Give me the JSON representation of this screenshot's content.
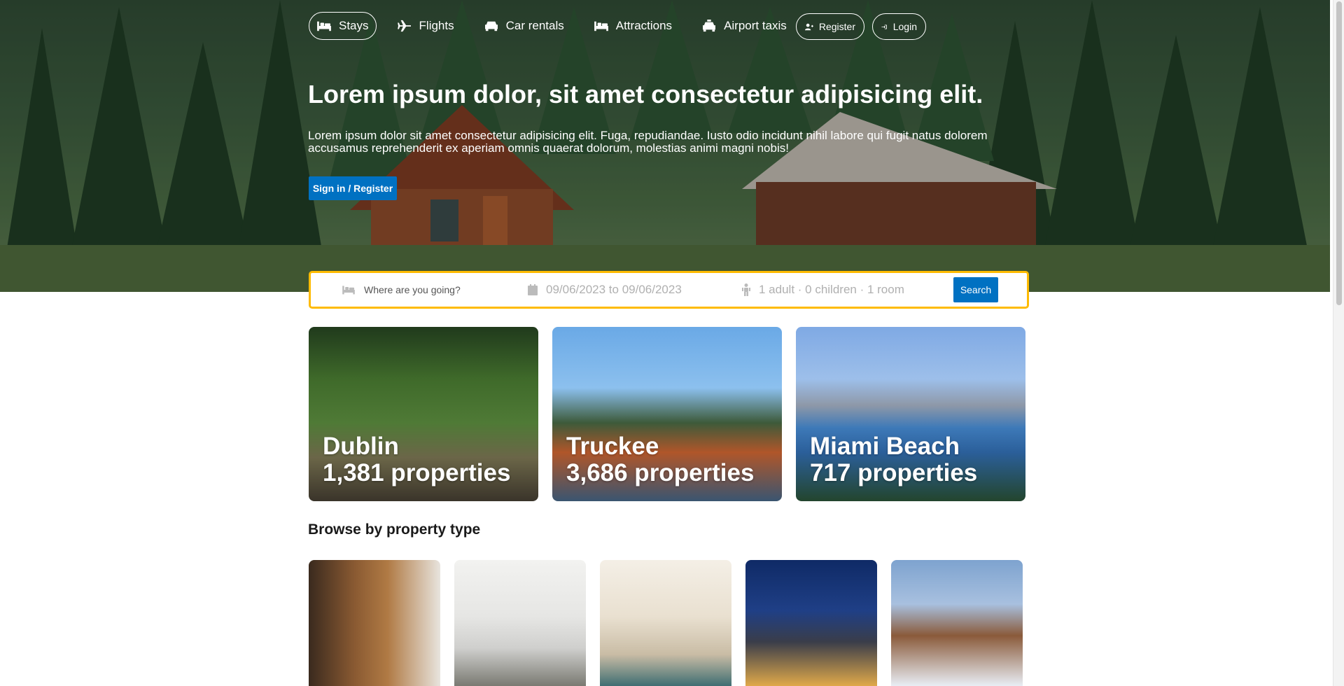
{
  "nav": {
    "items": [
      {
        "label": "Stays",
        "icon": "bed-icon",
        "active": true
      },
      {
        "label": "Flights",
        "icon": "plane-icon",
        "active": false
      },
      {
        "label": "Car rentals",
        "icon": "car-icon",
        "active": false
      },
      {
        "label": "Attractions",
        "icon": "bed-icon",
        "active": false
      },
      {
        "label": "Airport taxis",
        "icon": "taxi-icon",
        "active": false
      }
    ],
    "register_label": "Register",
    "login_label": "Login"
  },
  "hero": {
    "title": "Lorem ipsum dolor, sit amet consectetur adipisicing elit.",
    "description": "Lorem ipsum dolor sit amet consectetur adipisicing elit. Fuga, repudiandae. Iusto odio incidunt nihil labore qui fugit natus dolorem accusamus reprehenderit ex aperiam omnis quaerat dolorum, molestias animi magni nobis!",
    "cta_label": "Sign in / Register"
  },
  "search": {
    "destination_placeholder": "Where are you going?",
    "dates": "09/06/2023 to 09/06/2023",
    "guests": "1 adult · 0 children · 1 room",
    "button_label": "Search"
  },
  "featured": [
    {
      "city": "Dublin",
      "properties": "1,381 properties"
    },
    {
      "city": "Truckee",
      "properties": "3,686 properties"
    },
    {
      "city": "Miami Beach",
      "properties": "717 properties"
    }
  ],
  "property_types": {
    "title": "Browse by property type"
  },
  "colors": {
    "accent": "#0071c2",
    "search_border": "#febb02"
  }
}
